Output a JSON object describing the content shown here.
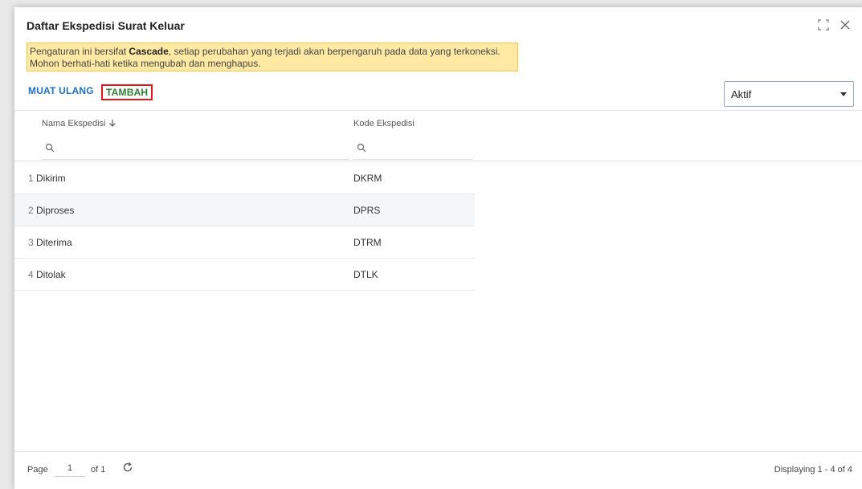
{
  "window": {
    "title": "Daftar Ekspedisi Surat Keluar"
  },
  "notice": {
    "prefix": "Pengaturan ini bersifat ",
    "bold": "Cascade",
    "suffix": ", setiap perubahan yang terjadi akan berpengaruh pada data yang terkoneksi.",
    "line2": "Mohon berhati-hati ketika mengubah dan menghapus."
  },
  "toolbar": {
    "reload_label": "MUAT ULANG",
    "add_label": "TAMBAH",
    "status_value": "Aktif"
  },
  "table": {
    "columns": [
      "Nama Ekspedisi",
      "Kode Ekspedisi"
    ],
    "rows": [
      {
        "num": "1",
        "name": "Dikirim",
        "code": "DKRM"
      },
      {
        "num": "2",
        "name": "Diproses",
        "code": "DPRS"
      },
      {
        "num": "3",
        "name": "Diterima",
        "code": "DTRM"
      },
      {
        "num": "4",
        "name": "Ditolak",
        "code": "DTLK"
      }
    ]
  },
  "pager": {
    "page_label": "Page",
    "page_value": "1",
    "of_label": "of 1",
    "display": "Displaying 1 - 4 of 4"
  },
  "icons": {
    "sort": "arrow-down-icon",
    "search": "search-icon",
    "maximize": "maximize-icon",
    "close": "close-icon",
    "refresh": "refresh-icon"
  }
}
